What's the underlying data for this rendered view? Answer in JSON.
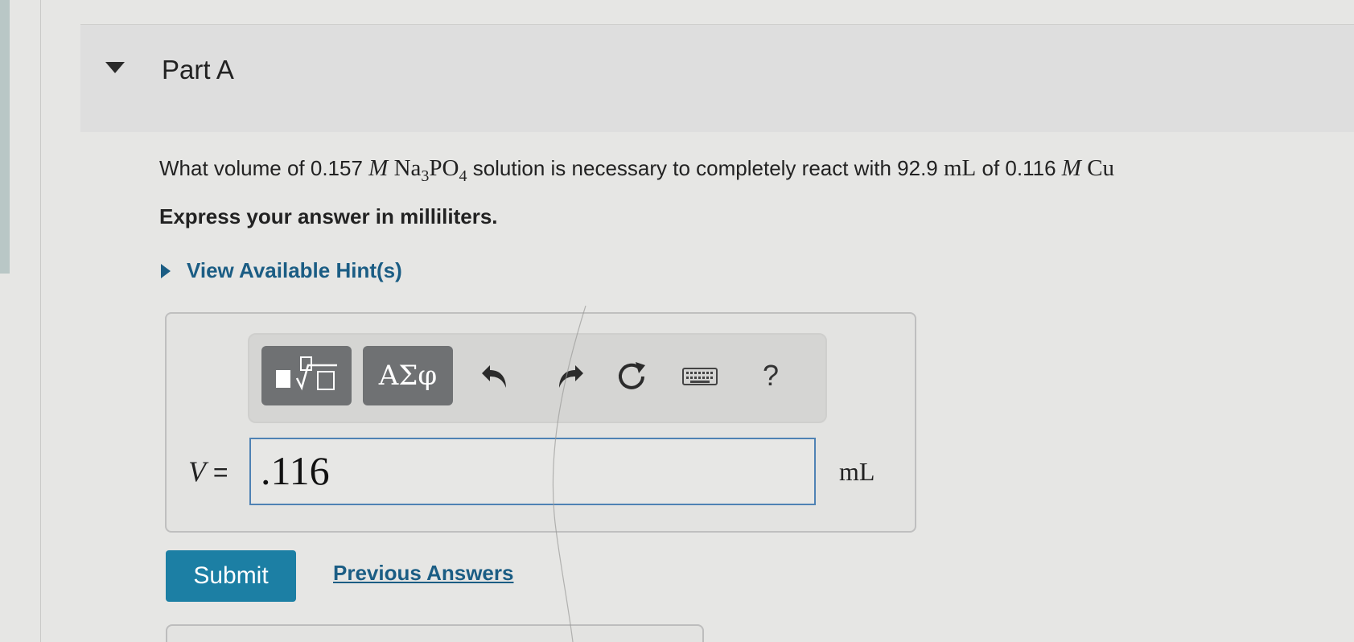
{
  "part": {
    "title": "Part A"
  },
  "question": {
    "prefix": "What volume of 0.157 ",
    "molarity_unit_1": "M",
    "formula_na": "Na",
    "formula_sub3": "3",
    "formula_po": "PO",
    "formula_sub4": "4",
    "middle": " solution is necessary to completely react with 92.9 ",
    "volume_unit": "mL",
    "of_text": " of 0.116 ",
    "molarity_unit_2": "M",
    "formula_cu": "Cu"
  },
  "instruction": "Express your answer in milliliters.",
  "hint": {
    "label": "View Available Hint(s)"
  },
  "toolbar": {
    "templates_icon": "templates-icon",
    "symbols_label": "ΑΣφ",
    "undo_icon": "undo-icon",
    "redo_icon": "redo-icon",
    "reset_icon": "reset-icon",
    "keyboard_icon": "keyboard-icon",
    "help_label": "?"
  },
  "answer": {
    "variable": "V",
    "equals": "=",
    "value": ".116",
    "unit": "mL"
  },
  "actions": {
    "submit_label": "Submit",
    "previous_answers_label": "Previous Answers"
  },
  "colors": {
    "link": "#1b5d84",
    "submit_bg": "#1c7fa4",
    "toolbar_button_bg": "#6f7173",
    "input_border": "#4f82b4"
  }
}
